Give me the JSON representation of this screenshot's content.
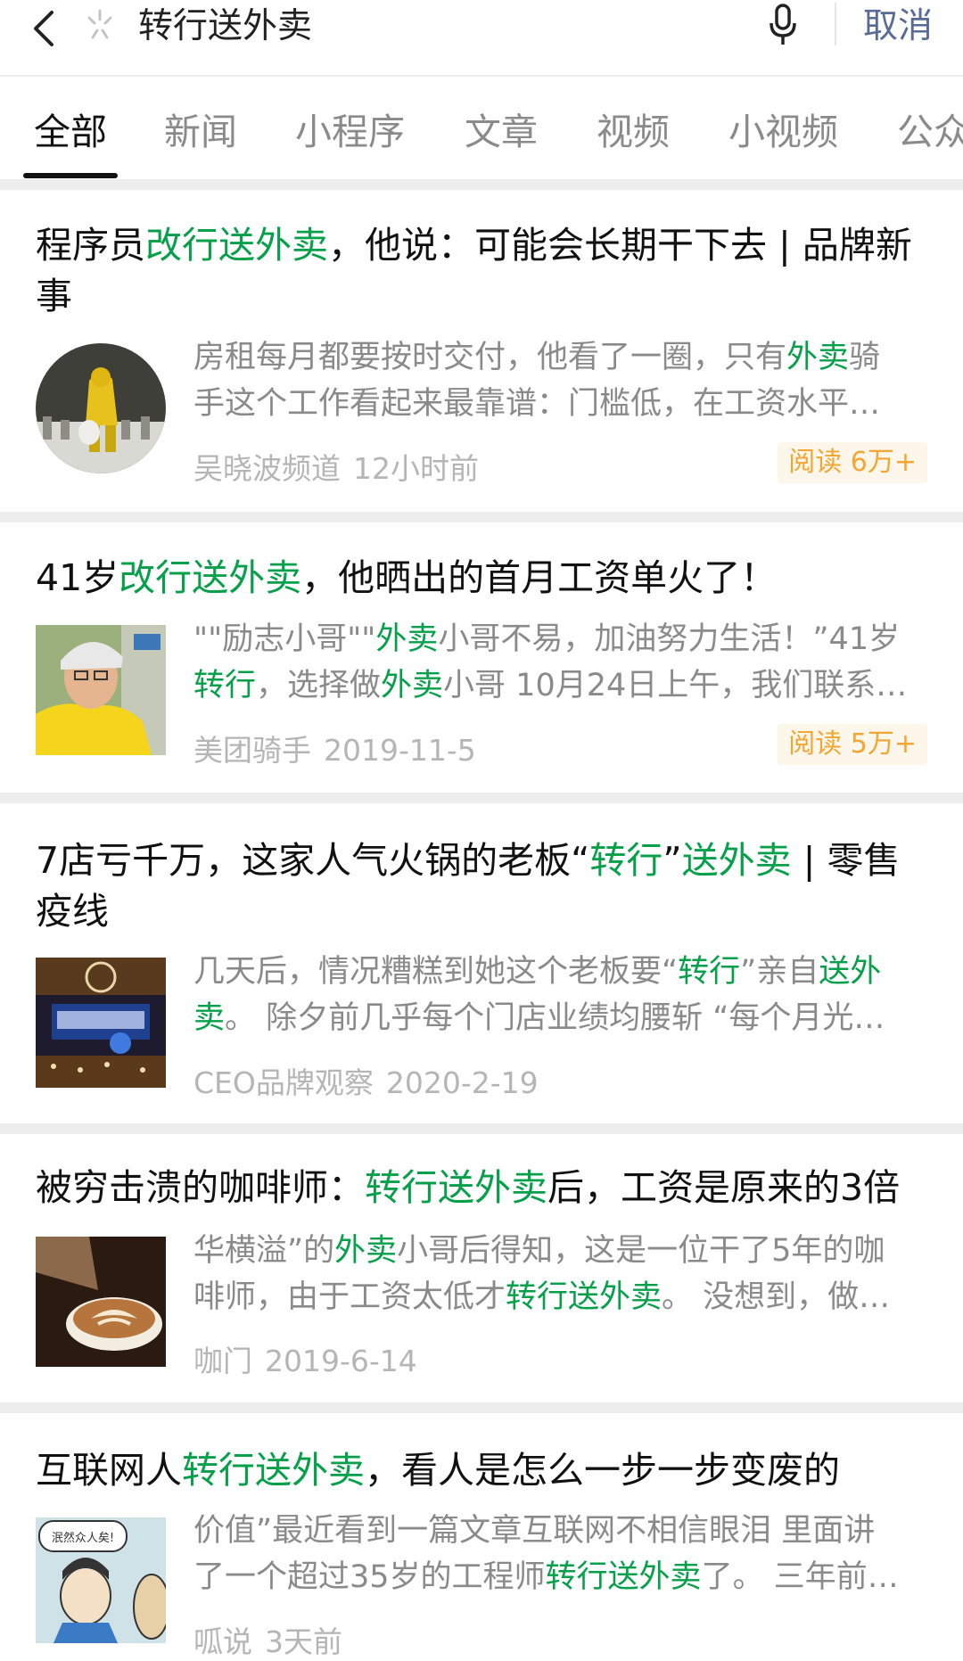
{
  "search": {
    "query": "转行送外卖",
    "cancel_label": "取消"
  },
  "icons": {
    "back": "chevron-left-icon",
    "loading": "loading-spinner-icon",
    "mic": "microphone-icon"
  },
  "tabs": [
    {
      "label": "全部",
      "active": true
    },
    {
      "label": "新闻"
    },
    {
      "label": "小程序"
    },
    {
      "label": "文章"
    },
    {
      "label": "视频"
    },
    {
      "label": "小视频"
    },
    {
      "label": "公众"
    }
  ],
  "colors": {
    "highlight": "#07a04a",
    "cancel": "#576b95",
    "badge_text": "#f3a632",
    "badge_bg": "#fdf6ea"
  },
  "results": [
    {
      "title": [
        {
          "t": "程序员"
        },
        {
          "t": "改行送外卖",
          "hl": true
        },
        {
          "t": "，他说：可能会长期干下去 | 品牌新"
        },
        {
          "br": true
        },
        {
          "t": "事"
        }
      ],
      "snippet": [
        [
          {
            "t": "房租每月都要按时交付，他看了一圈，只有"
          },
          {
            "t": "外卖",
            "hl": true
          },
          {
            "t": "骑"
          }
        ],
        [
          {
            "t": "手这个工作看起来最靠谱：门槛低，在工资水平…"
          }
        ]
      ],
      "source": "吴晓波频道",
      "time": "12小时前",
      "reads": "阅读 6万+",
      "thumb": "rider-in-yellow-raincoat"
    },
    {
      "title": [
        {
          "t": "41岁"
        },
        {
          "t": "改行送外卖",
          "hl": true
        },
        {
          "t": "，他晒出的首月工资单火了！"
        }
      ],
      "snippet": [
        [
          {
            "t": "\"\"励志小哥\"\""
          },
          {
            "t": "外卖",
            "hl": true
          },
          {
            "t": "小哥不易，加油努力生活！”41岁"
          }
        ],
        [
          {
            "t": "转行",
            "hl": true
          },
          {
            "t": "，选择做"
          },
          {
            "t": "外卖",
            "hl": true
          },
          {
            "t": "小哥 10月24日上午，我们联系…"
          }
        ]
      ],
      "source": "美团骑手",
      "time": "2019-11-5",
      "reads": "阅读 5万+",
      "thumb": "delivery-rider-portrait"
    },
    {
      "title": [
        {
          "t": "7店亏千万，这家人气火锅的老板“"
        },
        {
          "t": "转行",
          "hl": true
        },
        {
          "t": "”"
        },
        {
          "t": "送外卖",
          "hl": true
        },
        {
          "t": " | 零售"
        },
        {
          "br": true
        },
        {
          "t": "疫线"
        }
      ],
      "snippet": [
        [
          {
            "t": "几天后，情况糟糕到她这个老板要“"
          },
          {
            "t": "转行",
            "hl": true
          },
          {
            "t": "”亲自"
          },
          {
            "t": "送外",
            "hl": true
          }
        ],
        [
          {
            "t": "卖",
            "hl": true
          },
          {
            "t": "。 除夕前几乎每个门店业绩均腰斩 “每个月光…"
          }
        ]
      ],
      "source": "CEO品牌观察",
      "time": "2020-2-19",
      "reads": "",
      "thumb": "hotpot-restaurant-storefront"
    },
    {
      "title": [
        {
          "t": "被穷击溃的咖啡师："
        },
        {
          "t": "转行送外卖",
          "hl": true
        },
        {
          "t": "后，工资是原来的3倍"
        }
      ],
      "snippet": [
        [
          {
            "t": "华横溢”的"
          },
          {
            "t": "外卖",
            "hl": true
          },
          {
            "t": "小哥后得知，这是一位干了5年的咖"
          }
        ],
        [
          {
            "t": "啡师，由于工资太低才"
          },
          {
            "t": "转行送外卖",
            "hl": true
          },
          {
            "t": "。 没想到，做…"
          }
        ]
      ],
      "source": "咖门",
      "time": "2019-6-14",
      "reads": "",
      "thumb": "latte-art-coffee"
    },
    {
      "title": [
        {
          "t": "互联网人"
        },
        {
          "t": "转行送外卖",
          "hl": true
        },
        {
          "t": "，看人是怎么一步一步变废的"
        }
      ],
      "snippet": [
        [
          {
            "t": "价值”最近看到一篇文章互联网不相信眼泪 里面讲"
          }
        ],
        [
          {
            "t": "了一个超过35岁的工程师"
          },
          {
            "t": "转行送外卖",
            "hl": true
          },
          {
            "t": "了。 三年前…"
          }
        ]
      ],
      "source": "呱说",
      "time": "3天前",
      "reads": "",
      "thumb": "comic-illustration",
      "thumb_caption": "泯然众人矣!"
    }
  ]
}
